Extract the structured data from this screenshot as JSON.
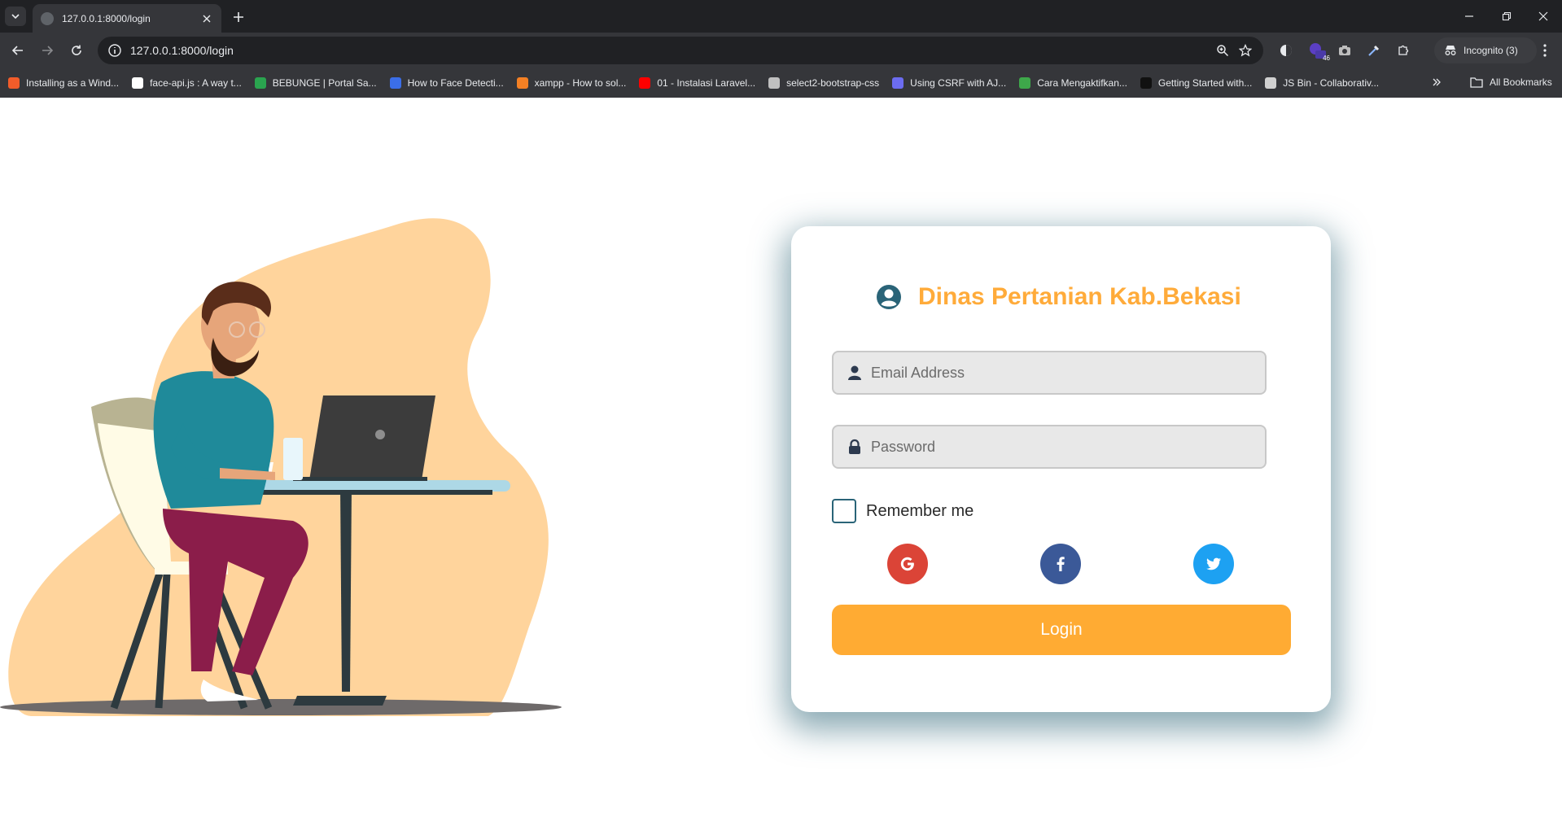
{
  "browser": {
    "tab": {
      "title": "127.0.0.1:8000/login"
    },
    "omnibox": {
      "url": "127.0.0.1:8000/login"
    },
    "extension_badge": "46",
    "incognito_label": "Incognito (3)",
    "bookmarks": [
      {
        "label": "Installing as a Wind...",
        "color": "#f25c2a"
      },
      {
        "label": "face-api.js : A way t...",
        "color": "#ffffff"
      },
      {
        "label": "BEBUNGE | Portal Sa...",
        "color": "#2aa44f"
      },
      {
        "label": "How to Face Detecti...",
        "color": "#3b6ee8"
      },
      {
        "label": "xampp - How to sol...",
        "color": "#f48024"
      },
      {
        "label": "01 - Instalasi Laravel...",
        "color": "#ff0000"
      },
      {
        "label": "select2-bootstrap-css",
        "color": "#c0c0c0"
      },
      {
        "label": "Using CSRF with AJ...",
        "color": "#6c6cf0"
      },
      {
        "label": "Cara Mengaktifkan...",
        "color": "#3ea84a"
      },
      {
        "label": "Getting Started with...",
        "color": "#111111"
      },
      {
        "label": "JS Bin - Collaborativ...",
        "color": "#d0d0d0"
      }
    ],
    "all_bookmarks_label": "All Bookmarks"
  },
  "login": {
    "title": "Dinas Pertanian Kab.Bekasi",
    "email_placeholder": "Email Address",
    "password_placeholder": "Password",
    "remember_label": "Remember me",
    "login_label": "Login",
    "social": [
      {
        "name": "google",
        "color": "#db4437"
      },
      {
        "name": "facebook",
        "color": "#3b5998"
      },
      {
        "name": "twitter",
        "color": "#1da1f2"
      }
    ]
  },
  "colors": {
    "accent": "#ffab33",
    "primary_dark": "#2a6478"
  }
}
